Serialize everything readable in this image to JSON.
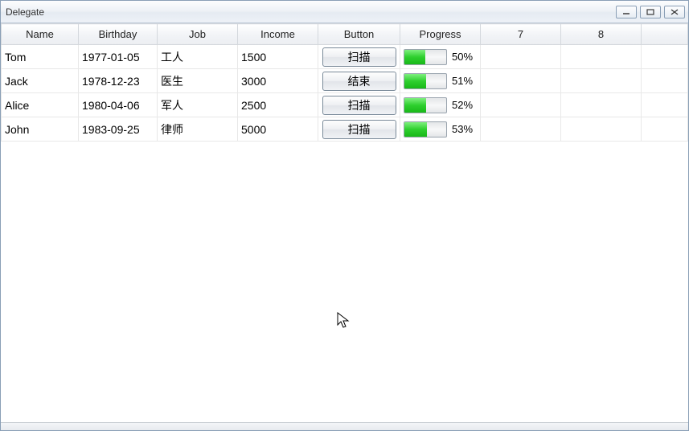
{
  "window": {
    "title": "Delegate"
  },
  "columns": {
    "name": "Name",
    "birthday": "Birthday",
    "job": "Job",
    "income": "Income",
    "button": "Button",
    "progress": "Progress",
    "c7": "7",
    "c8": "8"
  },
  "rows": [
    {
      "name": "Tom",
      "birthday": "1977-01-05",
      "job": "工人",
      "income": "1500",
      "button": "扫描",
      "progress_pct": 50,
      "progress_label": "50%"
    },
    {
      "name": "Jack",
      "birthday": "1978-12-23",
      "job": "医生",
      "income": "3000",
      "button": "结束",
      "progress_pct": 51,
      "progress_label": "51%"
    },
    {
      "name": "Alice",
      "birthday": "1980-04-06",
      "job": "军人",
      "income": "2500",
      "button": "扫描",
      "progress_pct": 52,
      "progress_label": "52%"
    },
    {
      "name": "John",
      "birthday": "1983-09-25",
      "job": "律师",
      "income": "5000",
      "button": "扫描",
      "progress_pct": 53,
      "progress_label": "53%"
    }
  ]
}
